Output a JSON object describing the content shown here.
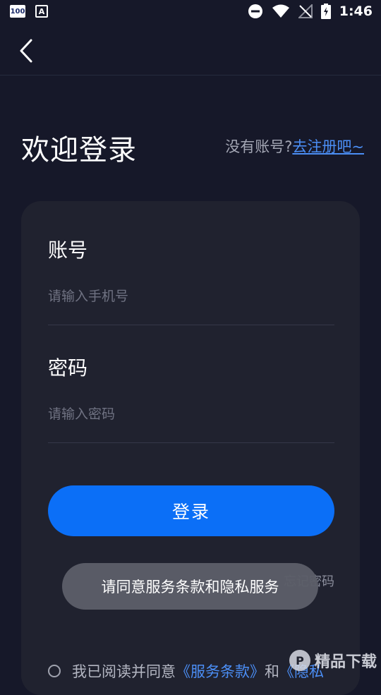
{
  "status_bar": {
    "badge_text": "100",
    "a_icon_text": "A",
    "time": "1:46"
  },
  "header": {
    "back_icon": "chevron-left-icon"
  },
  "page": {
    "title": "欢迎登录",
    "no_account_text": "没有账号?",
    "register_link": "去注册吧~"
  },
  "form": {
    "account_label": "账号",
    "account_placeholder": "请输入手机号",
    "password_label": "密码",
    "password_placeholder": "请输入密码",
    "login_button": "登录",
    "forgot_password": "忘记密码"
  },
  "toast": {
    "message": "请同意服务条款和隐私服务"
  },
  "agreement": {
    "prefix": "我已阅读并同意",
    "terms_link": "《服务条款》",
    "and_text": "和",
    "privacy_link": "《隐私"
  },
  "watermark": {
    "text": "精品下载"
  },
  "colors": {
    "background": "#161829",
    "card": "#20222f",
    "primary": "#0b6ff7",
    "link": "#4b8ef5"
  }
}
